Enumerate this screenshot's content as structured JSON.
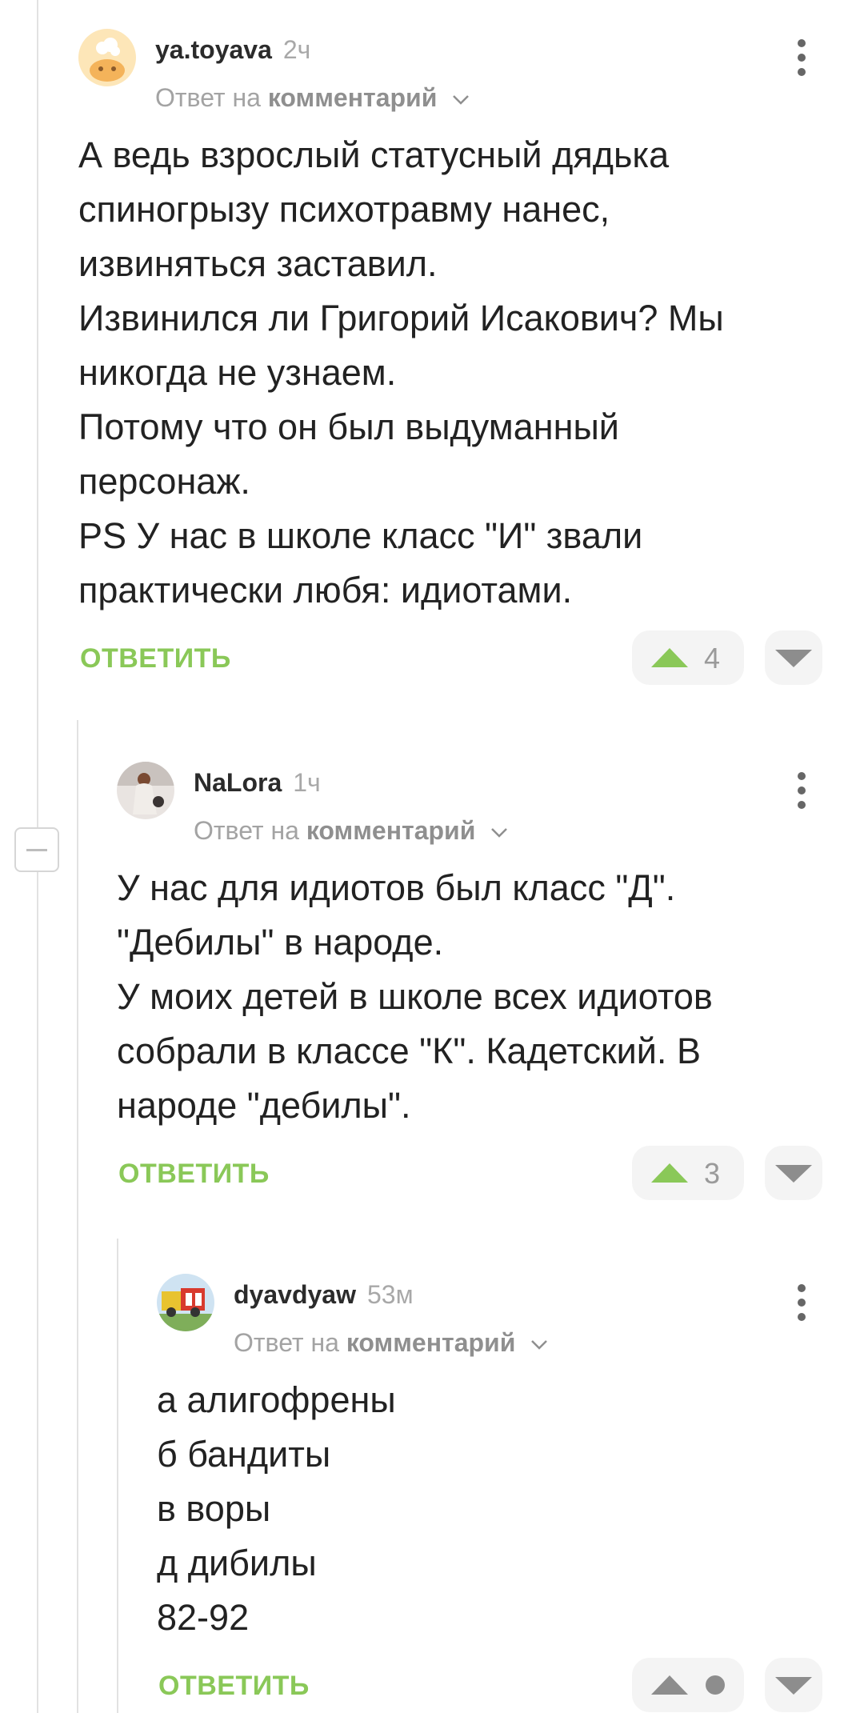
{
  "comments": [
    {
      "author": "ya.toyava",
      "time": "2ч",
      "reply_prefix": "Ответ на",
      "reply_target": "комментарий",
      "body": [
        "А ведь взрослый статусный дядька",
        "спиногрызу психотравму нанес,",
        "извиняться заставил.",
        "Извинился ли Григорий Исакович? Мы",
        "никогда не узнаем.",
        "Потому что он был выдуманный",
        "персонаж.",
        "PS У нас в школе класс \"И\" звали",
        "практически любя: идиотами."
      ],
      "reply_label": "ОТВЕТИТЬ",
      "rating": "4"
    },
    {
      "author": "NaLora",
      "time": "1ч",
      "reply_prefix": "Ответ на",
      "reply_target": "комментарий",
      "body": [
        "У нас для идиотов был класс \"Д\".",
        "\"Дебилы\" в народе.",
        "У моих детей в школе всех идиотов",
        "собрали в классе \"К\". Кадетский. В",
        "народе \"дебилы\"."
      ],
      "reply_label": "ОТВЕТИТЬ",
      "rating": "3"
    },
    {
      "author": "dyavdyaw",
      "time": "53м",
      "reply_prefix": "Ответ на",
      "reply_target": "комментарий",
      "body": [
        "а алигофрены",
        "б бандиты",
        "в воры",
        "д дибилы",
        "82-92"
      ],
      "reply_label": "ОТВЕТИТЬ",
      "rating": ""
    }
  ],
  "icons": {
    "menu": "more-vertical-icon",
    "chevron": "chevron-down-icon",
    "upvote": "arrow-up-icon",
    "downvote": "arrow-down-icon",
    "collapse": "minus-icon"
  },
  "colors": {
    "accent_green": "#8ac858",
    "muted_text": "#a3a3a3",
    "vote_bg": "#f4f4f4"
  }
}
